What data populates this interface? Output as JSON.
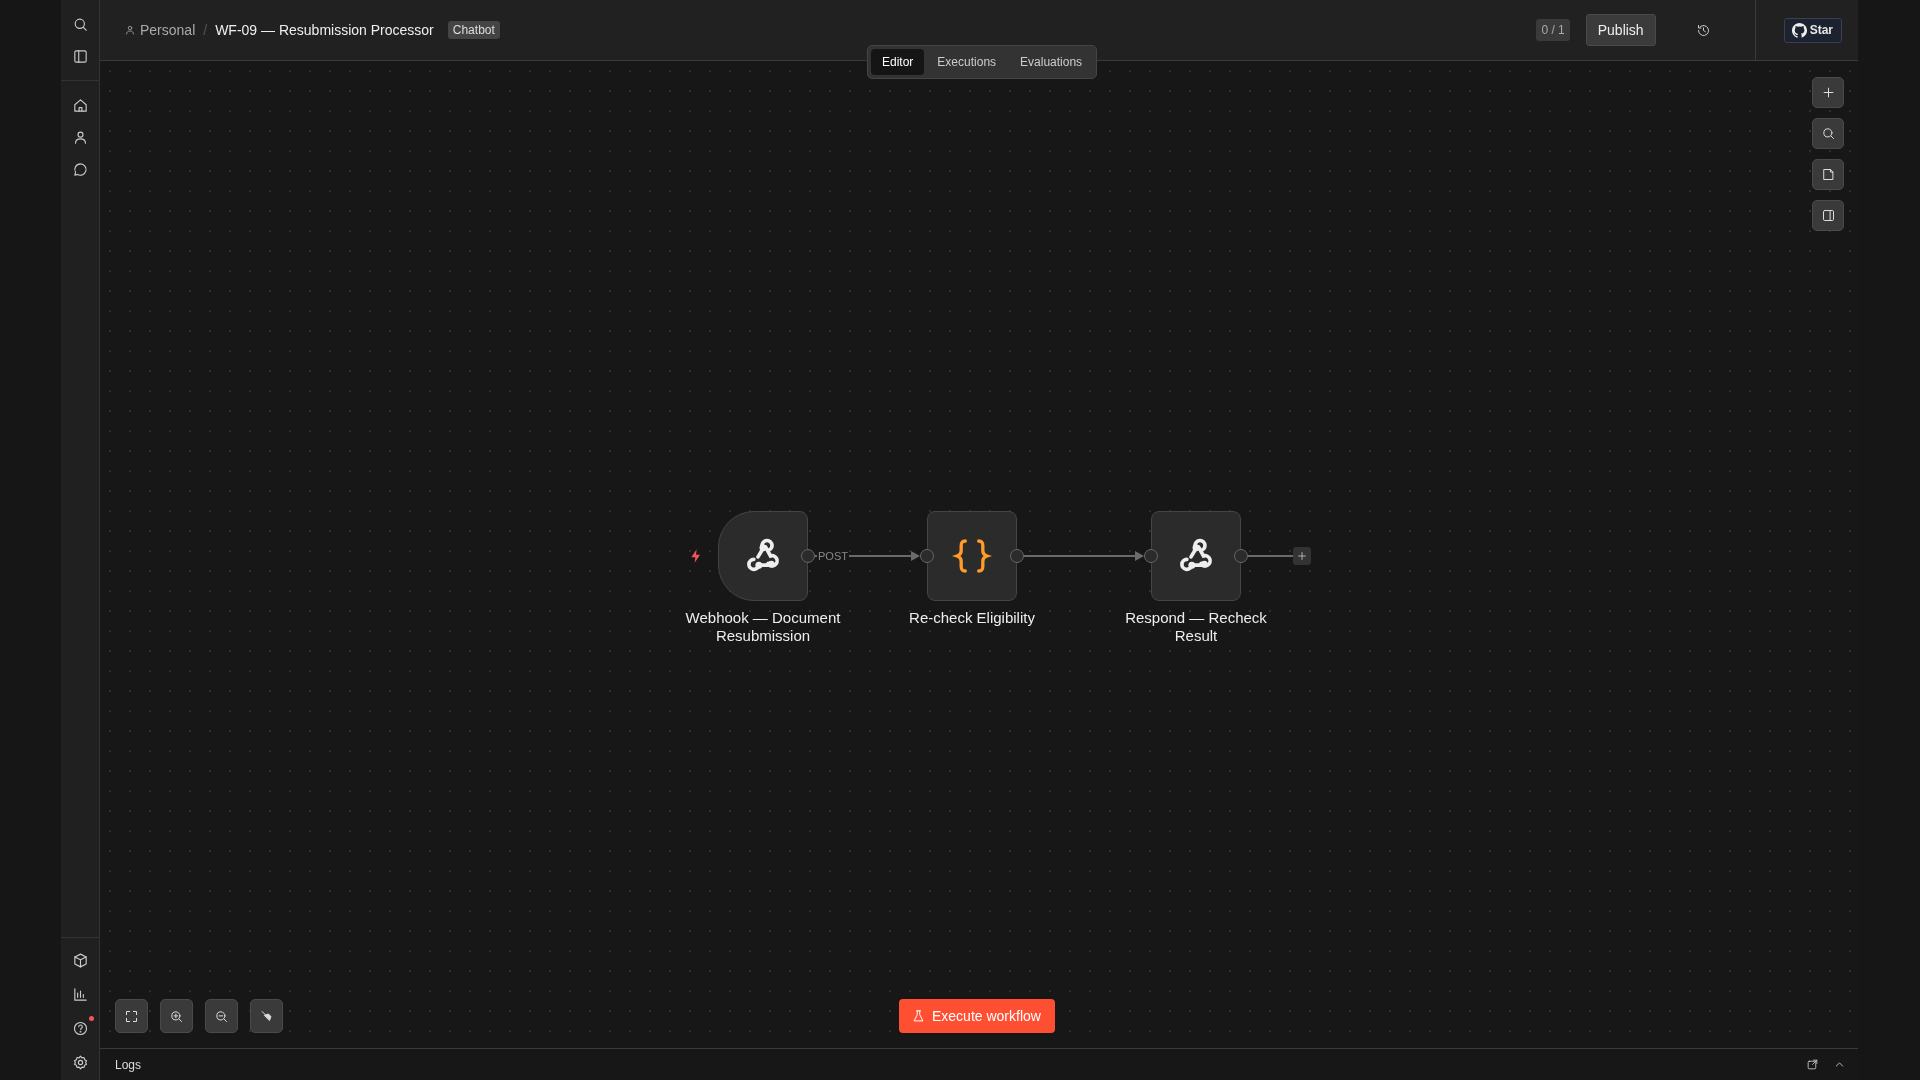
{
  "breadcrumb": {
    "project": "Personal",
    "separator": "/",
    "workflow": "WF-09 — Resubmission Processor",
    "tag": "Chatbot"
  },
  "tabs": [
    {
      "label": "Editor",
      "selected": true
    },
    {
      "label": "Executions",
      "selected": false
    },
    {
      "label": "Evaluations",
      "selected": false
    }
  ],
  "header": {
    "counter": "0 / 1",
    "publish": "Publish",
    "star": "Star"
  },
  "sidebar": {
    "top": [
      {
        "kind": "search"
      },
      {
        "kind": "panel"
      }
    ],
    "nav": [
      {
        "kind": "home"
      },
      {
        "kind": "user"
      },
      {
        "kind": "chat"
      }
    ],
    "bottom": [
      {
        "kind": "box",
        "notification": false
      },
      {
        "kind": "chart",
        "notification": false
      },
      {
        "kind": "help",
        "notification": true
      },
      {
        "kind": "settings",
        "notification": false
      }
    ]
  },
  "canvas_tools": [
    {
      "kind": "add"
    },
    {
      "kind": "search"
    },
    {
      "kind": "note"
    },
    {
      "kind": "panel"
    }
  ],
  "nodes": [
    {
      "kind": "webhook",
      "label": "Webhook — Document Resubmission",
      "trigger": true,
      "output_label": "POST"
    },
    {
      "kind": "code",
      "label": "Re-check Eligibility",
      "trigger": false
    },
    {
      "kind": "webhook",
      "label": "Respond — Recheck Result",
      "trigger": false
    }
  ],
  "zoom_tools": [
    {
      "kind": "fit"
    },
    {
      "kind": "zoom-in"
    },
    {
      "kind": "zoom-out"
    },
    {
      "kind": "tidy"
    }
  ],
  "execute": "Execute workflow",
  "logs": {
    "title": "Logs"
  }
}
